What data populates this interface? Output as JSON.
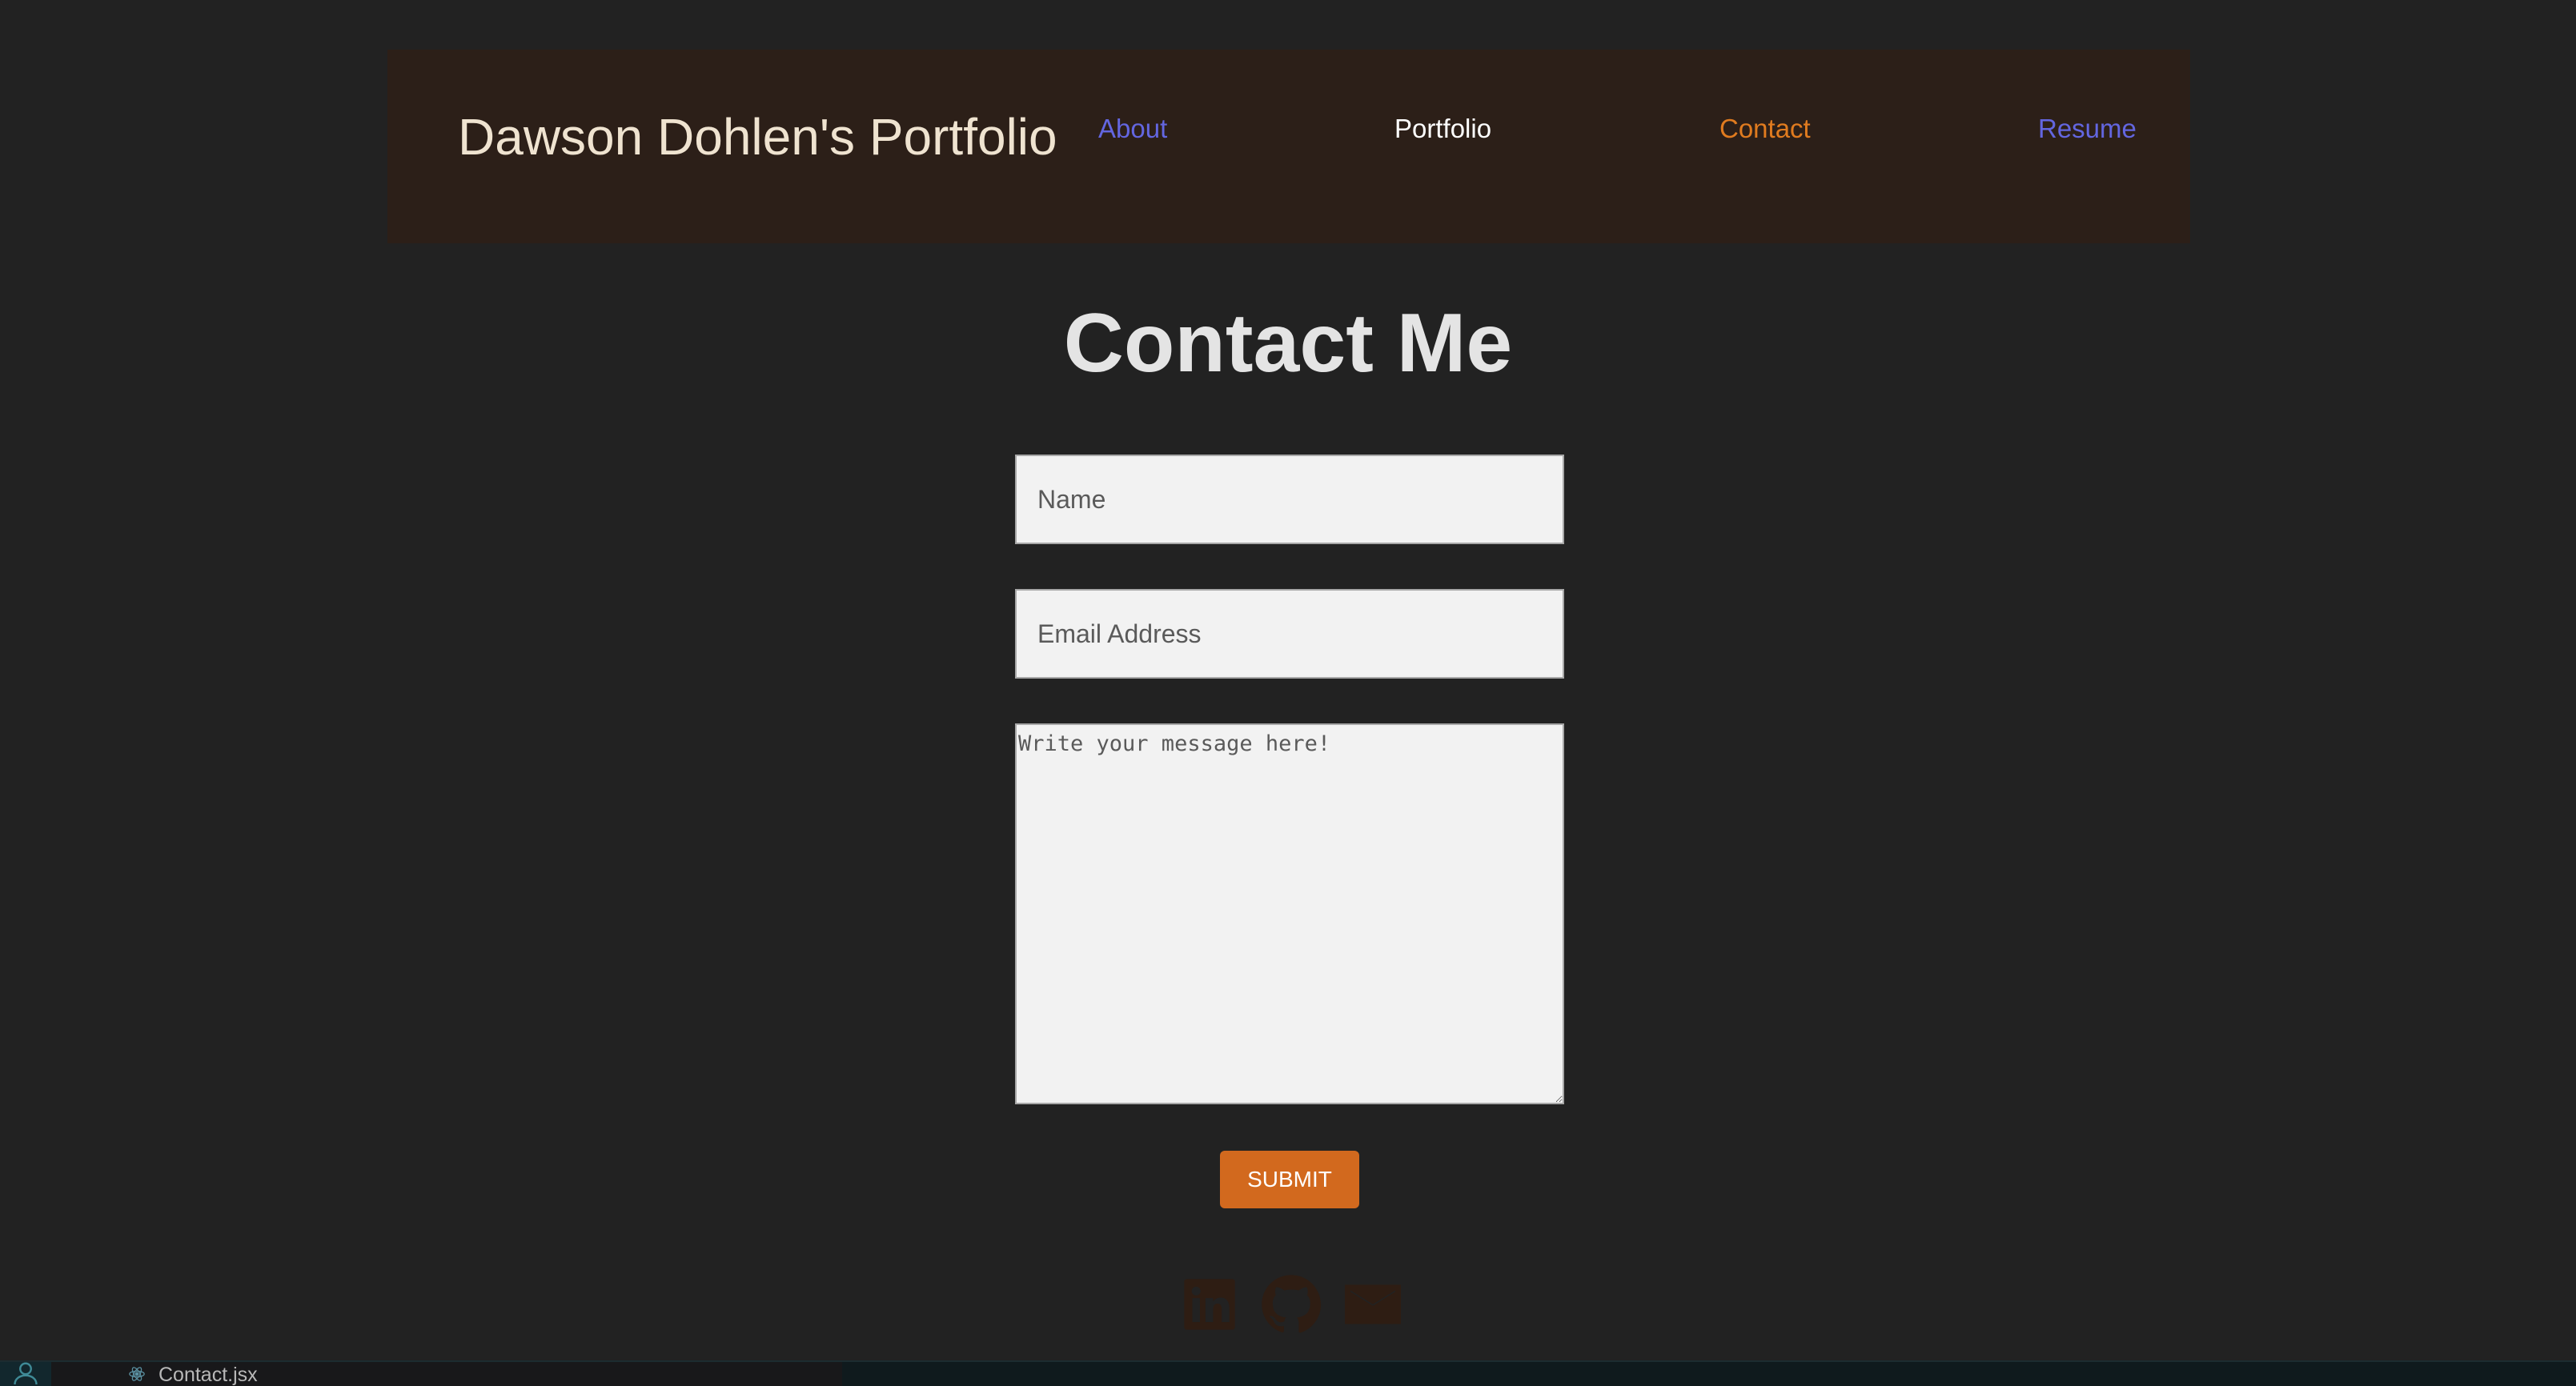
{
  "header": {
    "title": "Dawson Dohlen's Portfolio",
    "nav": [
      {
        "label": "About",
        "color": "#6366e0"
      },
      {
        "label": "Portfolio",
        "color": "#ffffff"
      },
      {
        "label": "Contact",
        "color": "#e07b1f"
      },
      {
        "label": "Resume",
        "color": "#6366e0"
      }
    ]
  },
  "main": {
    "heading": "Contact Me",
    "form": {
      "name_placeholder": "Name",
      "name_value": "",
      "email_placeholder": "Email Address",
      "email_value": "",
      "message_placeholder": "Write your message here!",
      "message_value": "",
      "submit_label": "SUBMIT"
    }
  },
  "footer": {
    "socials": [
      {
        "icon": "linkedin-icon"
      },
      {
        "icon": "github-icon"
      },
      {
        "icon": "email-icon"
      }
    ],
    "icon_color": "#2e1d13"
  },
  "statusbar": {
    "file_tab": "Contact.jsx",
    "tab_icon": "react-icon",
    "account_icon": "account-icon"
  },
  "colors": {
    "background": "#222222",
    "header_bg": "#2c1f18",
    "accent": "#d2691e"
  }
}
